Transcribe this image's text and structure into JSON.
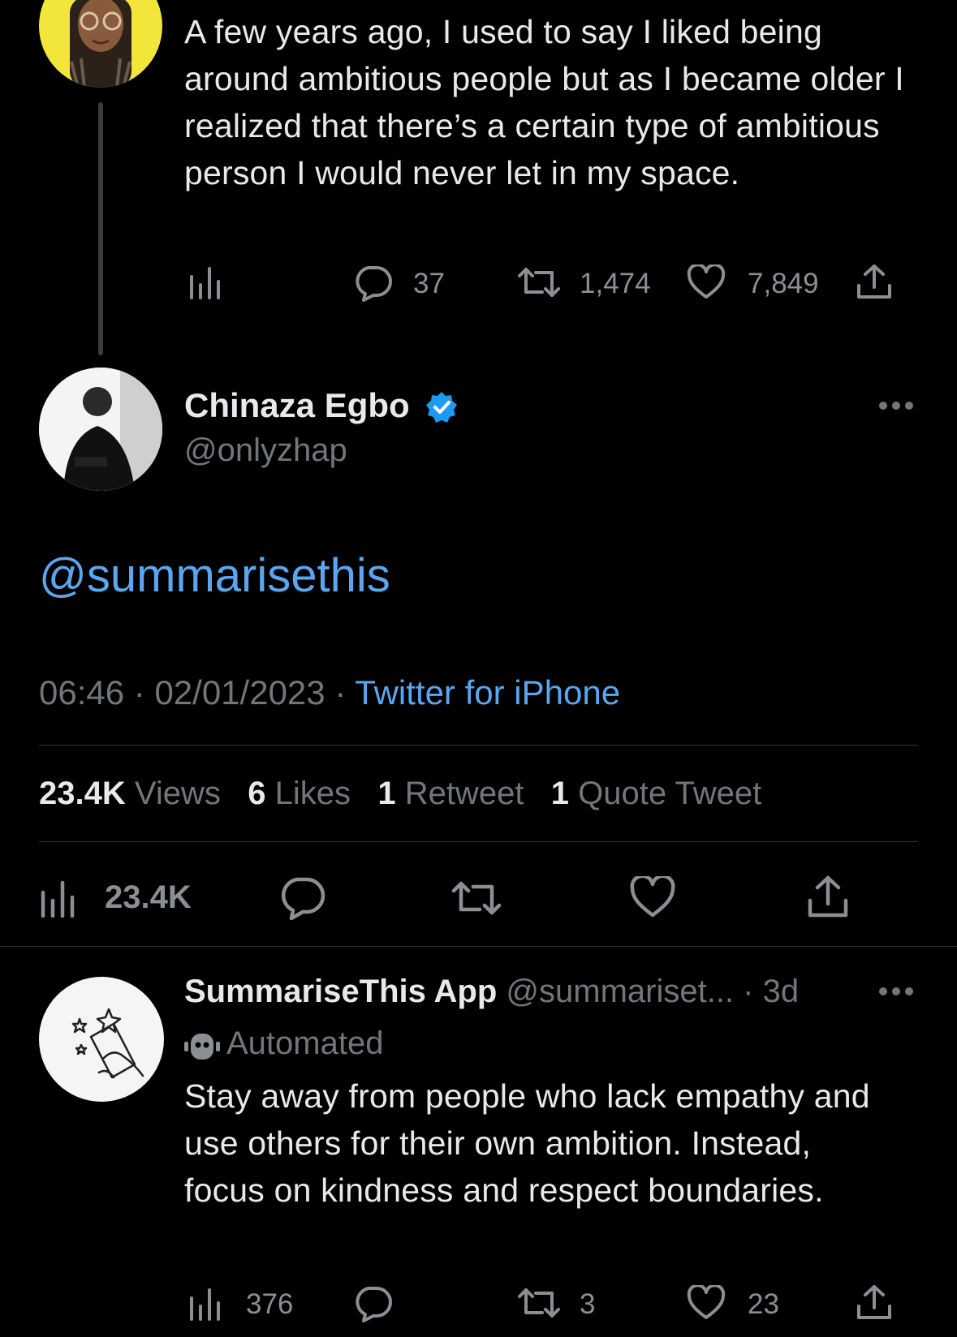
{
  "parent_tweet": {
    "text": "A few years ago, I used to say I liked being around ambitious people but as I became older I realized that there’s a certain type of ambitious person I would never let in my space.",
    "replies": "37",
    "retweets": "1,474",
    "likes": "7,849"
  },
  "main_tweet": {
    "display_name": "Chinaza Egbo",
    "handle": "@onlyzhap",
    "body_mention": "@summarisethis",
    "time": "06:46",
    "date": "02/01/2023",
    "client": "Twitter for iPhone",
    "stats": [
      {
        "num": "23.4K",
        "label": "Views"
      },
      {
        "num": "6",
        "label": "Likes"
      },
      {
        "num": "1",
        "label": "Retweet"
      },
      {
        "num": "1",
        "label": "Quote Tweet"
      }
    ],
    "views_count": "23.4K"
  },
  "reply_tweet": {
    "display_name": "SummariseThis App",
    "handle": "@summariset...",
    "age": "3d",
    "automated_label": "Automated",
    "text": "Stay away from people who lack empathy and use others for their own ambition. Instead, focus on kindness and respect boundaries.",
    "views": "376",
    "retweets": "3",
    "likes": "23"
  },
  "colors": {
    "background": "#000000",
    "text": "#e7e9ea",
    "muted": "#71767b",
    "accent_blue": "#1d9bf0",
    "verified": "#1d9bf0"
  },
  "icons": [
    "views-icon",
    "reply-icon",
    "retweet-icon",
    "like-icon",
    "share-icon",
    "verified-badge-icon",
    "more-icon",
    "automated-robot-icon"
  ]
}
